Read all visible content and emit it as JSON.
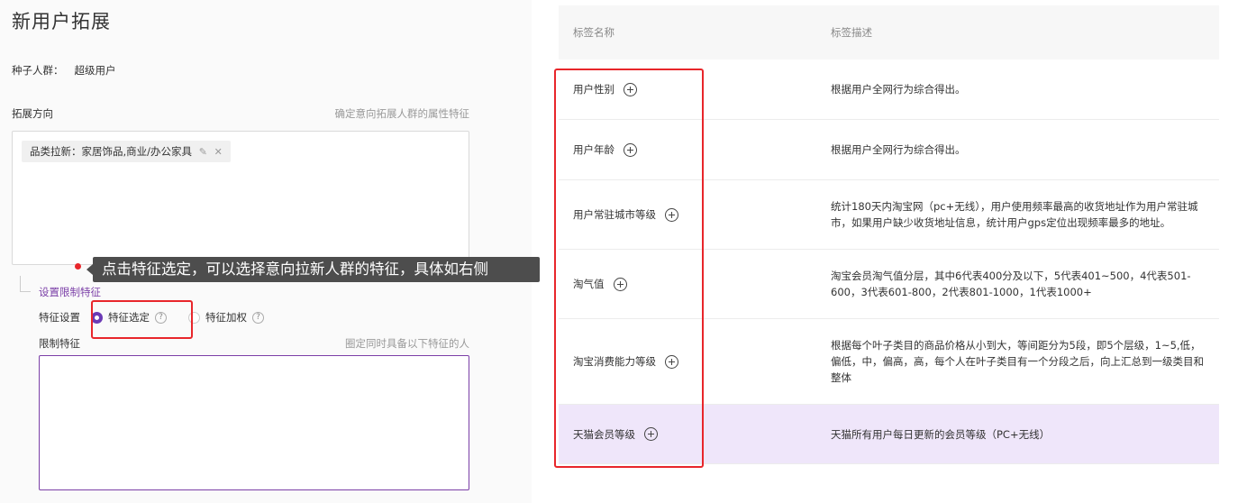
{
  "left": {
    "title": "新用户拓展",
    "seed_label": "种子人群：",
    "seed_value": "超级用户",
    "direction_label": "拓展方向",
    "direction_hint": "确定意向拓展人群的属性特征",
    "chip_label": "品类拉新：家居饰品,商业/办公家具",
    "chip_edit_icon": "✎",
    "chip_close_icon": "✕",
    "limit_link": "设置限制特征",
    "feature_setting_label": "特征设置",
    "option_select": "特征选定",
    "option_weight": "特征加权",
    "help_icon": "?",
    "limit_label": "限制特征",
    "limit_hint": "圈定同时具备以下特征的人",
    "tooltip": "点击特征选定，可以选择意向拉新人群的特征，具体如右侧"
  },
  "table": {
    "col_name": "标签名称",
    "col_desc": "标签描述",
    "rows": [
      {
        "name": "用户性别",
        "desc": "根据用户全网行为综合得出。"
      },
      {
        "name": "用户年龄",
        "desc": "根据用户全网行为综合得出。"
      },
      {
        "name": "用户常驻城市等级",
        "desc": "统计180天内淘宝网（pc+无线），用户使用频率最高的收货地址作为用户常驻城市，如果用户缺少收货地址信息，统计用户gps定位出现频率最多的地址。"
      },
      {
        "name": "淘气值",
        "desc": "淘宝会员淘气值分层，其中6代表400分及以下，5代表401~500，4代表501-600，3代表601-800，2代表801-1000，1代表1000+"
      },
      {
        "name": "淘宝消费能力等级",
        "desc": "根据每个叶子类目的商品价格从小到大，等间距分为5段，即5个层级，1~5,低，偏低，中，偏高，高，每个人在叶子类目有一个分段之后，向上汇总到一级类目和整体"
      },
      {
        "name": "天猫会员等级",
        "desc": "天猫所有用户每日更新的会员等级（PC+无线）"
      }
    ]
  },
  "colors": {
    "accent": "#6b3ab5",
    "highlight": "#e8262b",
    "row_highlight": "#efe6fa"
  }
}
